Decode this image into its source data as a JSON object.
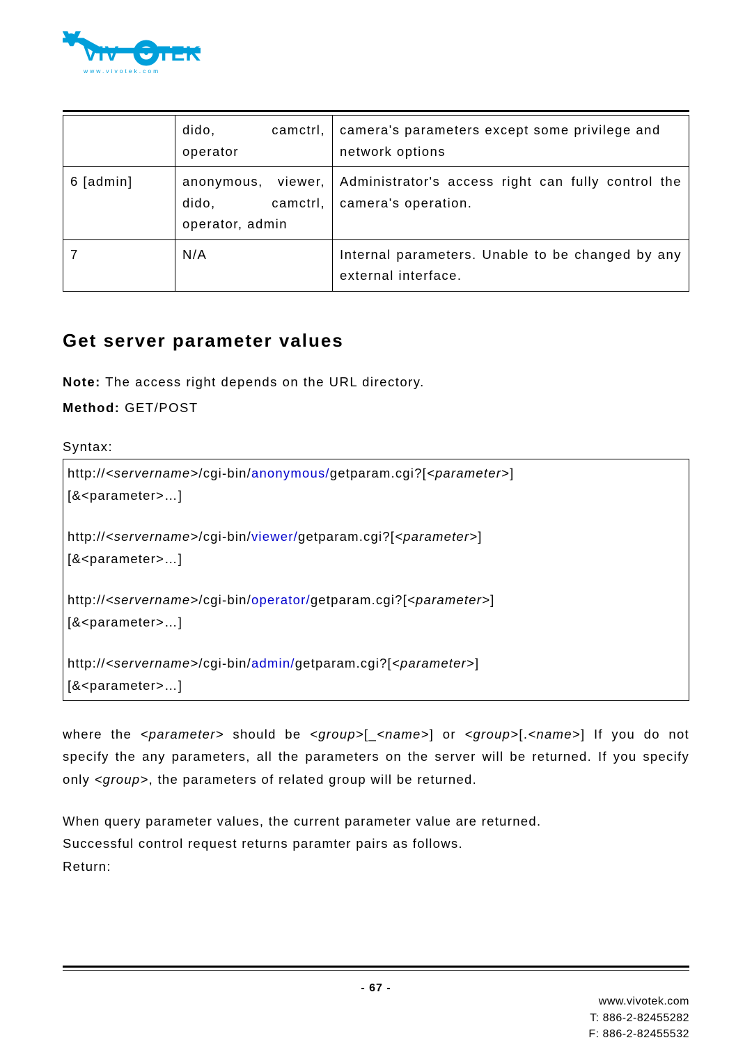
{
  "logo": {
    "brand": "VIVOTEK",
    "url_text": "www.vivotek.com"
  },
  "table": {
    "rows": [
      {
        "c1": "",
        "c2": "dido, camctrl, operator",
        "c3": "camera's parameters except some privilege and network options"
      },
      {
        "c1": "6 [admin]",
        "c2": "anonymous, viewer, dido, camctrl, operator, admin",
        "c3": "Administrator's access right can fully control the camera's operation."
      },
      {
        "c1": "7",
        "c2": "N/A",
        "c3": "Internal parameters. Unable to be changed by any external interface."
      }
    ]
  },
  "section_title": "Get server parameter values",
  "note_label": "Note:",
  "note_text": " The access right depends on the URL directory.",
  "method_label": "Method:",
  "method_text": " GET/POST",
  "syntax_label": "Syntax:",
  "syntax": {
    "prefix": "http://",
    "server": "<servername>",
    "cgibin": "/cgi-bin/",
    "getparam": "getparam.cgi?[",
    "param_ital": "<parameter>",
    "close": "]",
    "tail": "[&<parameter>…]",
    "roles": {
      "anonymous": "anonymous/",
      "viewer": "viewer/",
      "operator": "operator/",
      "admin": "admin/"
    }
  },
  "explain": {
    "pre": "where the ",
    "p1": "<parameter>",
    "mid1": " should be ",
    "g1": "<group>",
    "b1": "[_",
    "n1": "<name>",
    "b2": "] or ",
    "g2": "<group>",
    "b3": "[.",
    "n2": "<name>",
    "b4": "] If you do not specify the any parameters, all the parameters on the server will be returned. If you specify only ",
    "g3": "<group>",
    "post": ", the parameters of related group will be returned."
  },
  "explain2_l1": "When query parameter values, the current parameter value are returned.",
  "explain2_l2": "Successful control request returns paramter pairs as follows.",
  "return_label": "Return:",
  "page_number": "- 67 -",
  "footer": {
    "site": "www.vivotek.com",
    "tel": "T: 886-2-82455282",
    "fax": "F: 886-2-82455532"
  }
}
